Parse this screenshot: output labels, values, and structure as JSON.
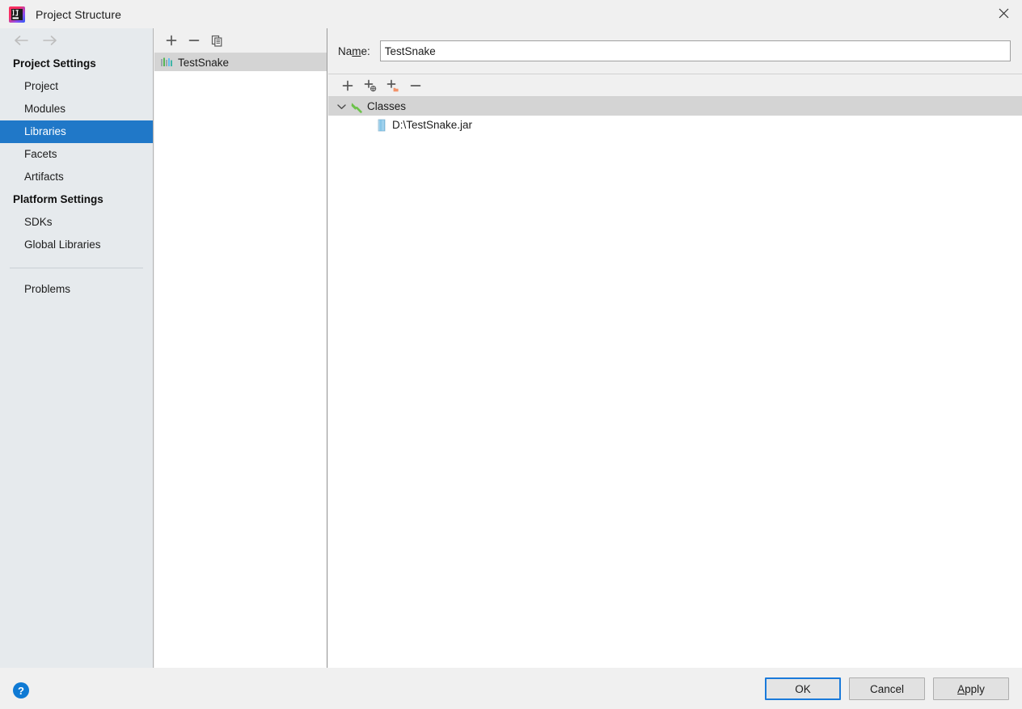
{
  "window": {
    "title": "Project Structure",
    "app_icon": "intellij-idea-icon",
    "close_icon": "close-icon"
  },
  "sidebar": {
    "nav": {
      "back_icon": "arrow-left-icon",
      "forward_icon": "arrow-right-icon"
    },
    "groups": [
      {
        "label": "Project Settings",
        "items": [
          {
            "label": "Project",
            "selected": false
          },
          {
            "label": "Modules",
            "selected": false
          },
          {
            "label": "Libraries",
            "selected": true
          },
          {
            "label": "Facets",
            "selected": false
          },
          {
            "label": "Artifacts",
            "selected": false
          }
        ]
      },
      {
        "label": "Platform Settings",
        "items": [
          {
            "label": "SDKs",
            "selected": false
          },
          {
            "label": "Global Libraries",
            "selected": false
          }
        ]
      }
    ],
    "problems": {
      "label": "Problems"
    }
  },
  "libraries_panel": {
    "toolbar": [
      {
        "name": "add-library-button",
        "icon": "plus-icon",
        "tooltip": "Add"
      },
      {
        "name": "remove-library-button",
        "icon": "minus-icon",
        "tooltip": "Remove"
      },
      {
        "name": "copy-library-button",
        "icon": "copy-icon",
        "tooltip": "Copy"
      }
    ],
    "items": [
      {
        "label": "TestSnake",
        "icon": "library-icon",
        "selected": true
      }
    ]
  },
  "details": {
    "name_field": {
      "label_prefix": "Na",
      "label_mnemonic": "m",
      "label_suffix": "e:",
      "value": "TestSnake",
      "placeholder": ""
    },
    "roots_toolbar": [
      {
        "name": "add-root-button",
        "icon": "plus-icon"
      },
      {
        "name": "add-url-root-button",
        "icon": "plus-globe-icon"
      },
      {
        "name": "add-folder-root-button",
        "icon": "plus-folder-icon"
      },
      {
        "name": "remove-root-button",
        "icon": "minus-icon"
      }
    ],
    "tree": [
      {
        "label": "Classes",
        "icon": "classes-root-icon",
        "expanded": true,
        "chevron": "chevron-down-icon",
        "children": [
          {
            "label": "D:\\TestSnake.jar",
            "icon": "jar-archive-icon"
          }
        ]
      }
    ]
  },
  "footer": {
    "help_icon": "help-icon",
    "buttons": [
      {
        "name": "ok-button",
        "label": "OK",
        "default": true,
        "mnemonic_index": -1
      },
      {
        "name": "cancel-button",
        "label": "Cancel",
        "default": false,
        "mnemonic_index": -1
      },
      {
        "name": "apply-button",
        "label": "Apply",
        "default": false,
        "mnemonic_index": 0
      }
    ],
    "apply_mnemonic": "A",
    "apply_rest": "pply"
  },
  "colors": {
    "selection_blue": "#2078c8",
    "sidebar_bg": "#e6eaed",
    "panel_bg": "#f0f0f0",
    "tree_group_bg": "#d4d4d4",
    "focus_ring": "#1a7ada"
  }
}
